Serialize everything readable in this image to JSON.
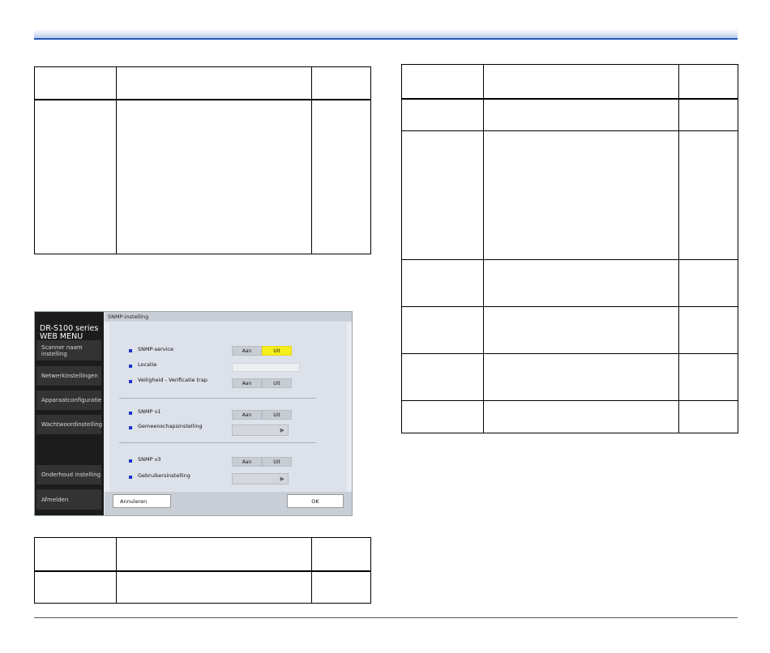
{
  "screenshot": {
    "brand": "DR-S100 series\nWEB MENU",
    "title": "SNMP-instelling",
    "menu": [
      "Scanner naam instelling",
      "Netwerkinstellingen",
      "Apparaatconfiguratie",
      "Wachtwoordinstelling",
      "Onderhoud instelling",
      "Afmelden"
    ],
    "rows": {
      "snmp_service": "SNMP-service",
      "locatie": "Locatie",
      "trap": "Veiligheid - Verificatie trap",
      "snmp_v1": "SNMP v1",
      "community": "Gemeenschapsinstelling",
      "snmp_v3": "SNMP v3",
      "user": "Gebruikersinstelling"
    },
    "toggle_on": "Aan",
    "toggle_off": "Uit",
    "cancel": "Annuleren",
    "ok": "OK",
    "accent_color": "#f7ee1e"
  }
}
